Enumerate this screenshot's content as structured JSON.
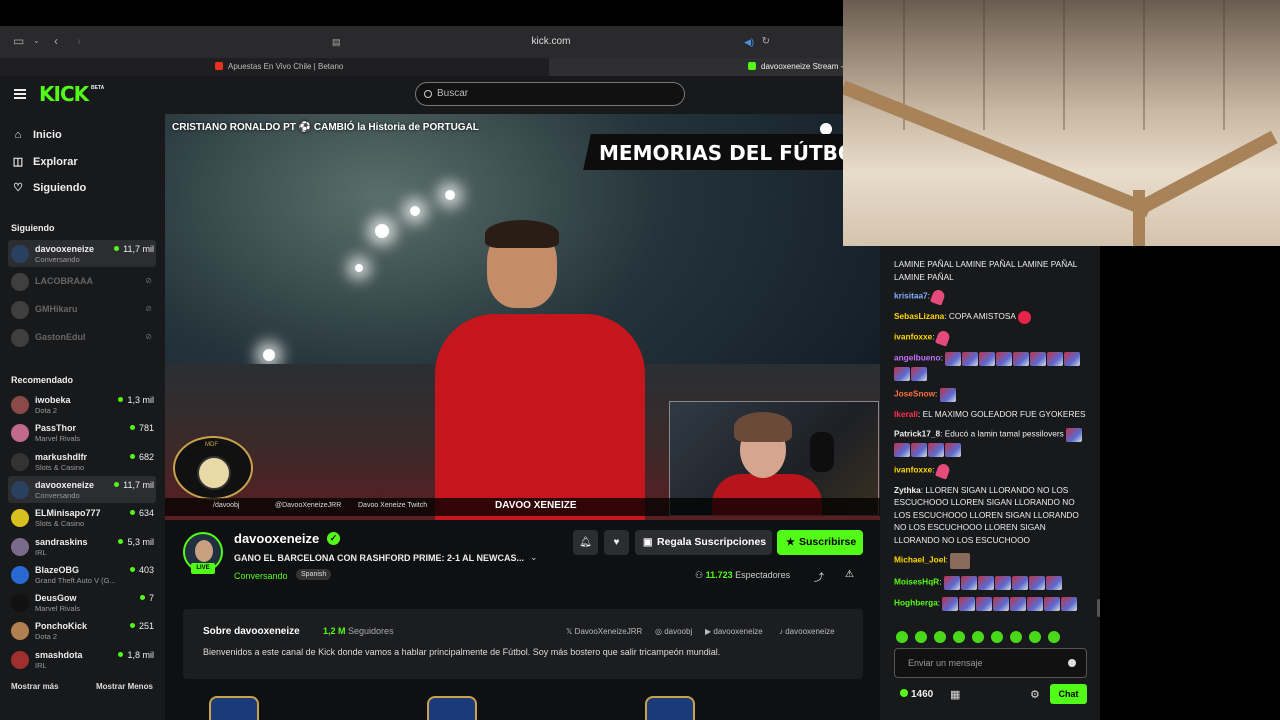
{
  "browser": {
    "url": "kick.com",
    "tabs": [
      {
        "label": "Apuestas En Vivo Chile | Betano",
        "icon": "betano-favicon",
        "color": "#e8321e"
      },
      {
        "label": "davooxeneize Stream - W",
        "icon": "kick-favicon",
        "color": "#53fc18"
      }
    ]
  },
  "header": {
    "logo": "KICK",
    "logo_badge": "BETA",
    "search_placeholder": "Buscar"
  },
  "sidebar": {
    "nav": [
      {
        "label": "Inicio",
        "icon": "home-icon"
      },
      {
        "label": "Explorar",
        "icon": "explore-icon"
      },
      {
        "label": "Siguiendo",
        "icon": "heart-icon"
      }
    ],
    "following_title": "Siguiendo",
    "following": [
      {
        "name": "davooxeneize",
        "category": "Conversando",
        "viewers": "11,7 mil",
        "live": true
      },
      {
        "name": "LACOBRAAA",
        "live": false
      },
      {
        "name": "GMHikaru",
        "live": false
      },
      {
        "name": "GastonEdul",
        "live": false
      }
    ],
    "recommended_title": "Recomendado",
    "recommended": [
      {
        "name": "iwobeka",
        "category": "Dota 2",
        "viewers": "1,3 mil",
        "color": "#8a4a4a"
      },
      {
        "name": "PassThor",
        "category": "Marvel Rivals",
        "viewers": "781",
        "color": "#c06a8a"
      },
      {
        "name": "markushdlfr",
        "category": "Slots & Casino",
        "viewers": "682",
        "color": "#333"
      },
      {
        "name": "davooxeneize",
        "category": "Conversando",
        "viewers": "11,7 mil",
        "color": "#2a4060"
      },
      {
        "name": "ELMinisapo777",
        "category": "Slots & Casino",
        "viewers": "634",
        "color": "#d8c020"
      },
      {
        "name": "sandraskins",
        "category": "IRL",
        "viewers": "5,3 mil",
        "color": "#7a6a8a"
      },
      {
        "name": "BlazeOBG",
        "category": "Grand Theft Auto V (G...",
        "viewers": "403",
        "color": "#2a6ad0"
      },
      {
        "name": "DeusGow",
        "category": "Marvel Rivals",
        "viewers": "7",
        "color": "#111"
      },
      {
        "name": "PonchoKick",
        "category": "Dota 2",
        "viewers": "251",
        "color": "#b08050"
      },
      {
        "name": "smashdota",
        "category": "IRL",
        "viewers": "1,8 mil",
        "color": "#a03030"
      }
    ],
    "show_more": "Mostrar más",
    "show_less": "Mostrar Menos"
  },
  "video": {
    "overlay_title": "CRISTIANO RONALDO PT ⚽ CAMBIÓ la Historia de PORTUGAL",
    "banner": "MEMORIAS DEL FÚTBOL",
    "mdf_logo": "MDF",
    "bottom_bar": {
      "kick": "/davoobj",
      "twitter": "@DavooXeneizeJRR",
      "twitch": "Davoo Xeneize Twitch",
      "caster": "DAVOO XENEIZE"
    }
  },
  "stream": {
    "streamer": "davooxeneize",
    "live_label": "LIVE",
    "title": "GANO EL BARCELONA CON RASHFORD PRIME: 2-1 AL NEWCAS...",
    "category": "Conversando",
    "language": "Spanish",
    "gift_label": "Regala Suscripciones",
    "subscribe_label": "Suscribirse",
    "viewers": "11.723",
    "viewers_label": "Espectadores"
  },
  "about": {
    "title": "Sobre davooxeneize",
    "followers": "1,2 M",
    "followers_label": "Seguidores",
    "description": "Bienvenidos a este canal de Kick donde vamos a hablar principalmente de Fútbol. Soy más bostero que salir tricampeón mundial.",
    "socials": [
      {
        "label": "DavooXeneizeJRR",
        "icon": "x-icon"
      },
      {
        "label": "davoobj",
        "icon": "instagram-icon"
      },
      {
        "label": "davooxeneize",
        "icon": "youtube-icon"
      },
      {
        "label": "davooxeneize",
        "icon": "tiktok-icon"
      }
    ]
  },
  "chat": {
    "messages": [
      {
        "user": "",
        "color": "#eeeeee",
        "text": "LAMINE PAÑAL LAMINE PAÑAL LAMINE PAÑAL LAMINE PAÑAL",
        "emotes": 0
      },
      {
        "user": "krisitaa7",
        "color": "#7fb0ff",
        "text": "",
        "emotes": 1,
        "emote_style": "pink"
      },
      {
        "user": "SebasLizana",
        "color": "#ffd700",
        "text": "COPA AMISTOSA",
        "emotes": 1,
        "emote_style": "red"
      },
      {
        "user": "ivanfoxxe",
        "color": "#ffd700",
        "text": "",
        "emotes": 1,
        "emote_style": "pink"
      },
      {
        "user": "angelbueno",
        "color": "#c070ff",
        "text": "",
        "emotes": 10,
        "emote_style": "flag"
      },
      {
        "user": "JoseSnow",
        "color": "#ff7040",
        "text": "",
        "emotes": 1,
        "emote_style": "flag"
      },
      {
        "user": "lkerali",
        "color": "#ff3050",
        "text": "EL MAXIMO GOLEADOR FUE GYOKERES",
        "emotes": 0
      },
      {
        "user": "Patrick17_8",
        "color": "#eeeeee",
        "text": "Educó a lamin tamal pessilovers",
        "emotes": 5,
        "emote_style": "flag"
      },
      {
        "user": "ivanfoxxe",
        "color": "#ffd700",
        "text": "",
        "emotes": 1,
        "emote_style": "pink"
      },
      {
        "user": "Zythka",
        "color": "#eeeeee",
        "text": "LLOREN SIGAN LLORANDO NO LOS ESCUCHOOO LLOREN SIGAN LLORANDO NO LOS ESCUCHOOO LLOREN SIGAN LLORANDO NO LOS ESCUCHOOO LLOREN SIGAN LLORANDO NO LOS ESCUCHOOO",
        "emotes": 0
      },
      {
        "user": "Michael_Joel",
        "color": "#ffd700",
        "text": "",
        "emotes": 1,
        "emote_style": "pic"
      },
      {
        "user": "MoisesHqR",
        "color": "#53fc18",
        "text": "",
        "emotes": 7,
        "emote_style": "flag"
      },
      {
        "user": "Hoghberga",
        "color": "#53fc18",
        "text": "",
        "emotes": 8,
        "emote_style": "flag"
      }
    ],
    "input_placeholder": "Enviar un mensaje",
    "points": "1460",
    "chat_button": "Chat"
  }
}
